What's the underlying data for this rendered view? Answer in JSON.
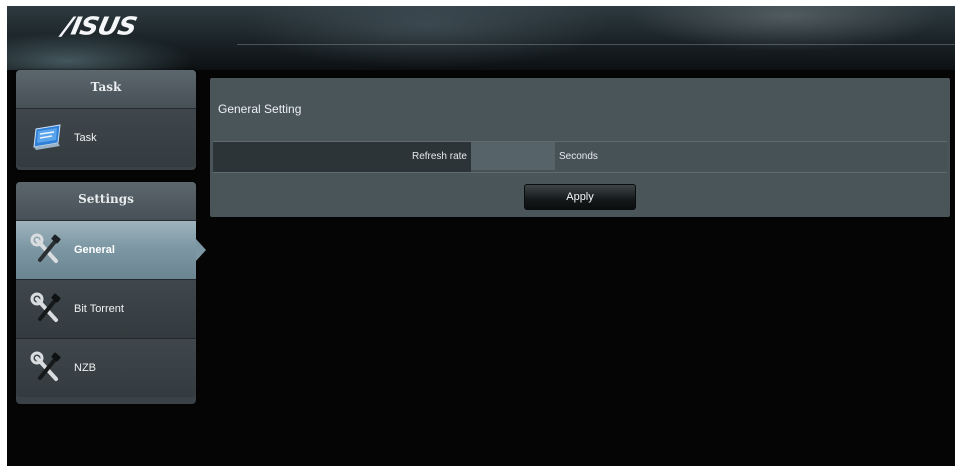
{
  "header": {
    "logo": "/ISUS"
  },
  "sidebar": {
    "task_panel": {
      "title": "Task",
      "items": [
        {
          "label": "Task",
          "icon": "task-monitor-icon",
          "active": false
        }
      ]
    },
    "settings_panel": {
      "title": "Settings",
      "items": [
        {
          "label": "General",
          "icon": "wrench-screwdriver-icon",
          "active": true
        },
        {
          "label": "Bit Torrent",
          "icon": "wrench-screwdriver-icon",
          "active": false
        },
        {
          "label": "NZB",
          "icon": "wrench-screwdriver-icon",
          "active": false
        }
      ]
    }
  },
  "main": {
    "section_title": "General Setting",
    "refresh_rate": {
      "label": "Refresh rate",
      "value": "",
      "unit": "Seconds"
    },
    "apply_label": "Apply"
  },
  "colors": {
    "page_background": "#050505",
    "panel_background": "#3a4247",
    "active_item": "#7d98a4",
    "content_background": "#4a555a",
    "button_dark": "#16191b"
  }
}
